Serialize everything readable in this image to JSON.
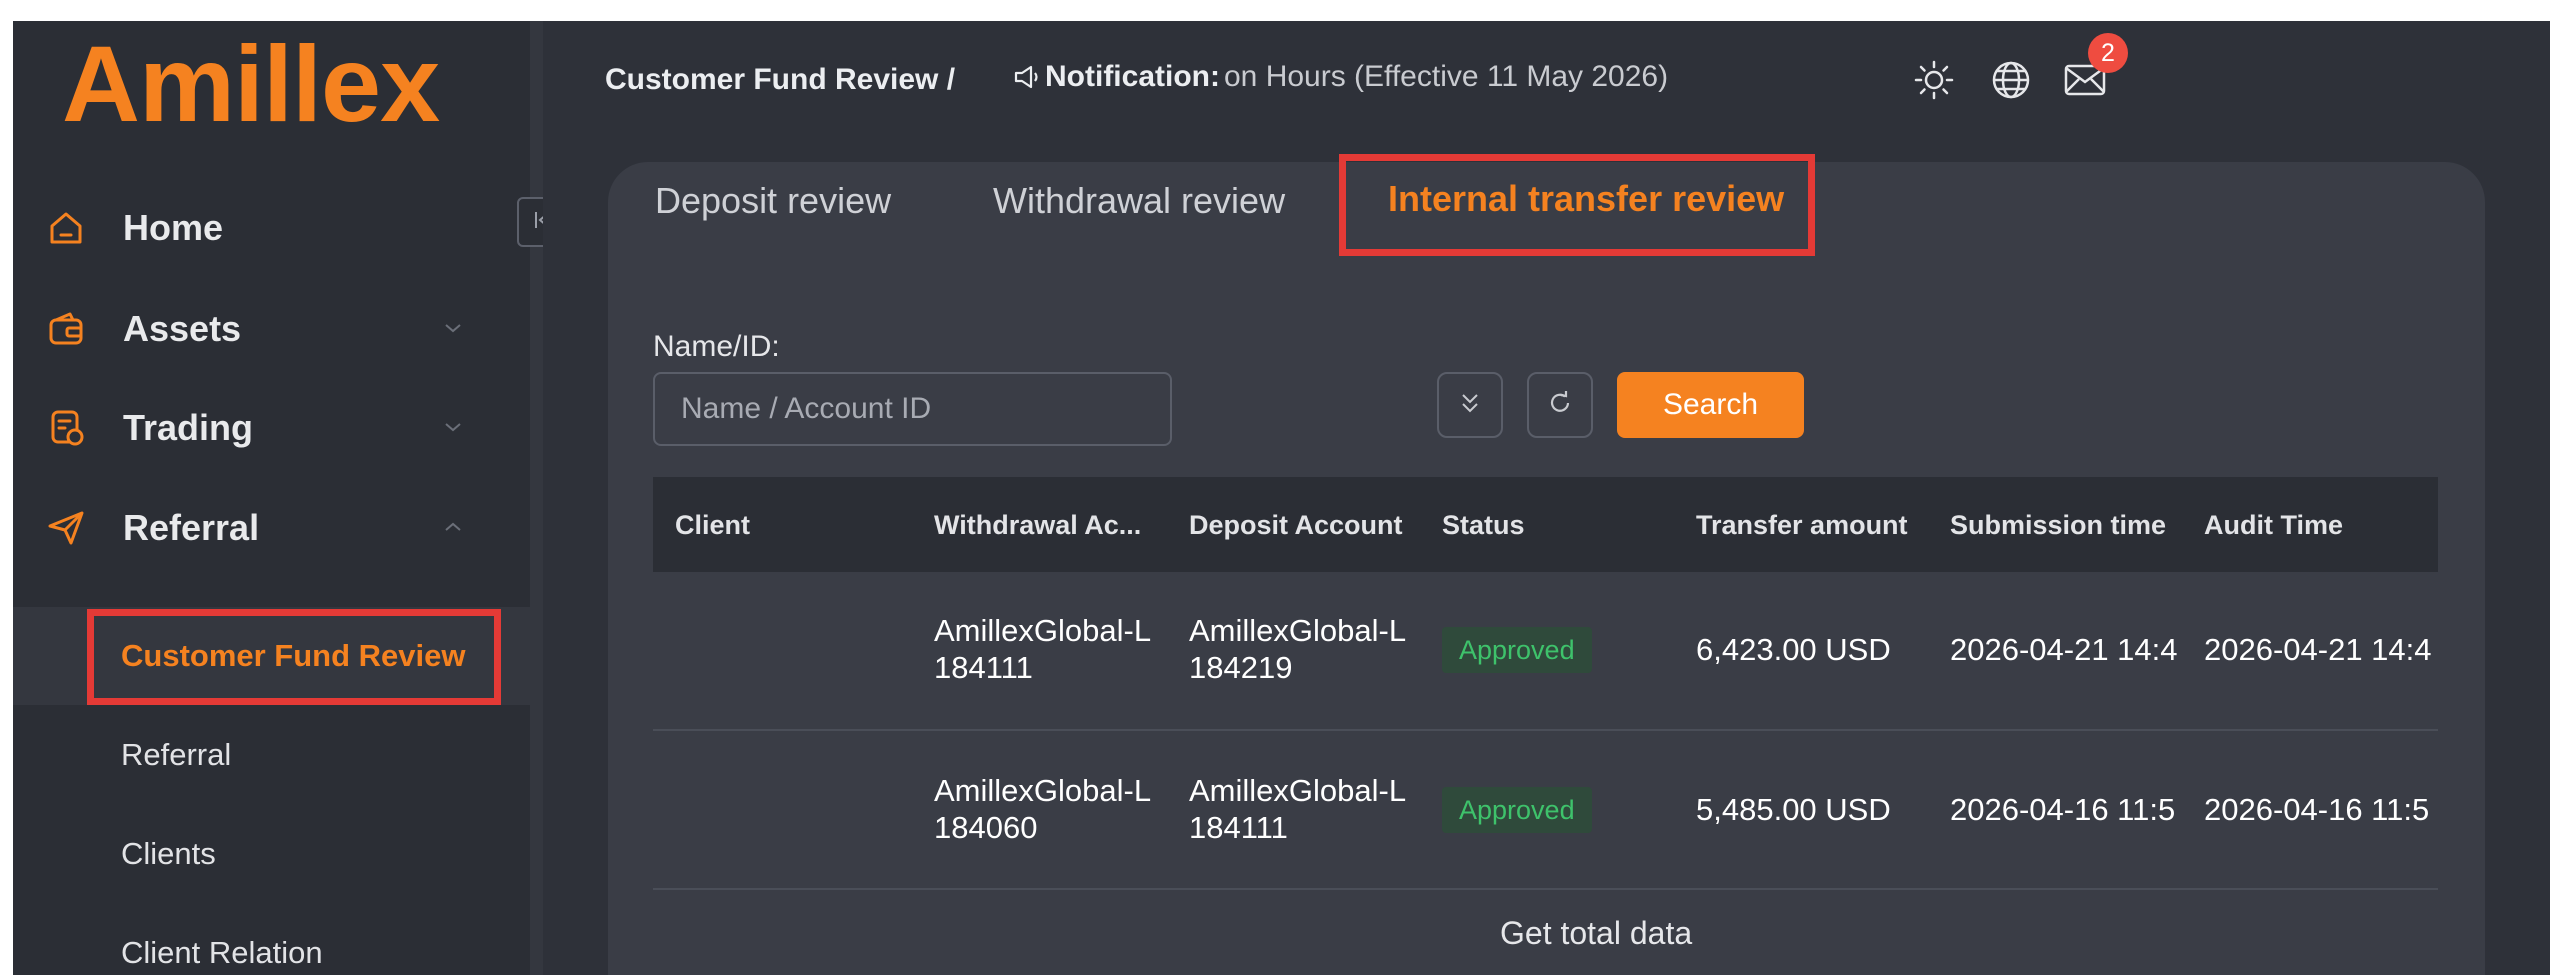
{
  "brand": {
    "logo_text": "Amillex",
    "accent": "#f58220"
  },
  "sidebar": {
    "items": [
      {
        "label": "Home",
        "icon": "home-icon",
        "chevron": null
      },
      {
        "label": "Assets",
        "icon": "wallet-icon",
        "chevron": "down"
      },
      {
        "label": "Trading",
        "icon": "trading-icon",
        "chevron": "down"
      },
      {
        "label": "Referral",
        "icon": "send-icon",
        "chevron": "up"
      }
    ],
    "sub_items": [
      {
        "label": "Customer Fund Review",
        "active": true
      },
      {
        "label": "Referral",
        "active": false
      },
      {
        "label": "Clients",
        "active": false
      },
      {
        "label": "Client Relation",
        "active": false
      }
    ]
  },
  "header": {
    "breadcrumb": "Customer Fund Review /",
    "notice_label": "Notification:",
    "notice_text": "on Hours (Effective 11 May 2026)",
    "icons": [
      "sun-icon",
      "globe-icon",
      "mail-icon"
    ],
    "mail_badge": "2"
  },
  "tabs": [
    {
      "label": "Deposit review",
      "active": false
    },
    {
      "label": "Withdrawal review",
      "active": false
    },
    {
      "label": "Internal transfer review",
      "active": true
    }
  ],
  "filters": {
    "label": "Name/ID:",
    "placeholder": "Name / Account ID",
    "value": "",
    "search_label": "Search"
  },
  "table": {
    "columns": [
      "Client",
      "Withdrawal Ac...",
      "Deposit Account",
      "Status",
      "Transfer amount",
      "Submission time",
      "Audit Time"
    ],
    "rows": [
      {
        "client": "",
        "withdrawal_line1": "AmillexGlobal-L",
        "withdrawal_line2": "184111",
        "deposit_line1": "AmillexGlobal-L",
        "deposit_line2": "184219",
        "status": "Approved",
        "amount": "6,423.00 USD",
        "submission_time": "2026-04-21 14:4",
        "audit_time": "2026-04-21 14:4"
      },
      {
        "client": "",
        "withdrawal_line1": "AmillexGlobal-L",
        "withdrawal_line2": "184060",
        "deposit_line1": "AmillexGlobal-L",
        "deposit_line2": "184111",
        "status": "Approved",
        "amount": "5,485.00 USD",
        "submission_time": "2026-04-16 11:5",
        "audit_time": "2026-04-16 11:5"
      }
    ],
    "footer_label": "Get total data"
  },
  "colors": {
    "sidebar_bg": "#2b2e35",
    "card_bg": "#3a3d46",
    "highlight_box": "#e43a36",
    "approved": "#3ec26b"
  }
}
